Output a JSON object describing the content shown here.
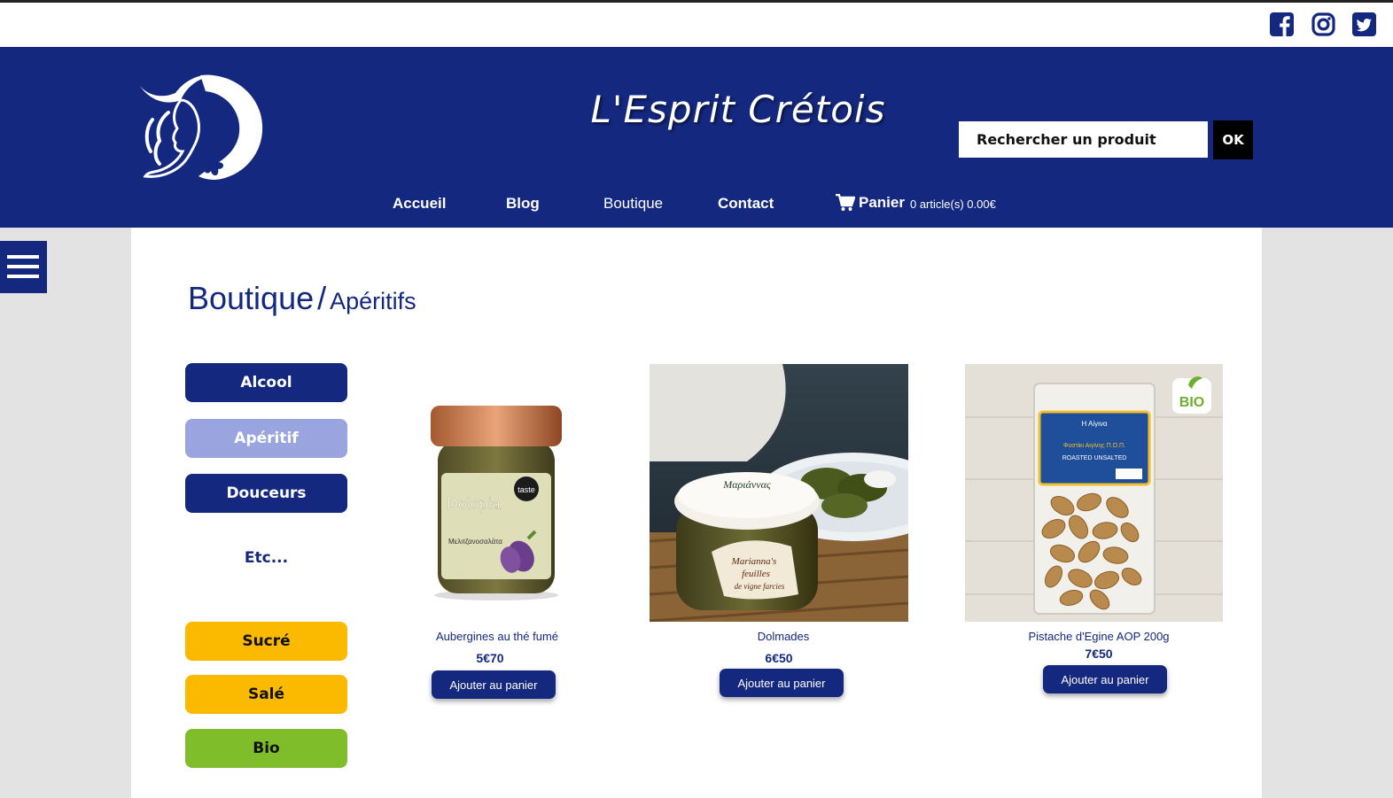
{
  "social": {
    "icons": [
      "facebook-icon",
      "instagram-icon",
      "twitter-icon"
    ],
    "color": "#14287f"
  },
  "header": {
    "title": "L'Esprit Crétois",
    "bg_color": "#14287f"
  },
  "search": {
    "placeholder": "Rechercher un produit",
    "button_label": "OK"
  },
  "nav": {
    "items": [
      {
        "label": "Accueil"
      },
      {
        "label": "Blog"
      },
      {
        "label": "Boutique"
      },
      {
        "label": "Contact"
      }
    ],
    "cart": {
      "label": "Panier",
      "info": "0 article(s) 0.00€"
    }
  },
  "breadcrumb": {
    "main": "Boutique",
    "separator": "/",
    "sub": "Apéritifs"
  },
  "categories": {
    "items": [
      {
        "label": "Alcool",
        "color": "#14287f"
      },
      {
        "label": "Apéritif",
        "color": "#9aa5e0"
      },
      {
        "label": "Douceurs",
        "color": "#14287f"
      },
      {
        "label": "Etc..."
      },
      {
        "label": "Sucré",
        "color": "#fbb900"
      },
      {
        "label": "Salé",
        "color": "#fbb900"
      },
      {
        "label": "Bio",
        "color": "#7fbd2a"
      }
    ]
  },
  "products": [
    {
      "name": "Aubergines au thé fumé",
      "price": "5€70",
      "button_label": "Ajouter au panier",
      "image_text": {
        "brand": "Dolopia",
        "badge": "taste",
        "subtitle": "Μελιτζανοσαλάτα"
      }
    },
    {
      "name": "Dolmades",
      "price": "6€50",
      "button_label": "Ajouter au panier",
      "image_text": {
        "lid": "Μαριάννας",
        "label_line1": "Marianna's",
        "label_line2": "feuilles",
        "label_line3": "de vigne farcies"
      }
    },
    {
      "name": "Pistache d'Egine AOP 200g",
      "price": "7€50",
      "button_label": "Ajouter au panier",
      "image_text": {
        "badge": "BIO",
        "pack_line1": "Η Αίγινα",
        "pack_line2": "Φυστίκι Αιγίνης Π.Ο.Π.",
        "pack_line3": "ROASTED UNSALTED"
      }
    }
  ]
}
